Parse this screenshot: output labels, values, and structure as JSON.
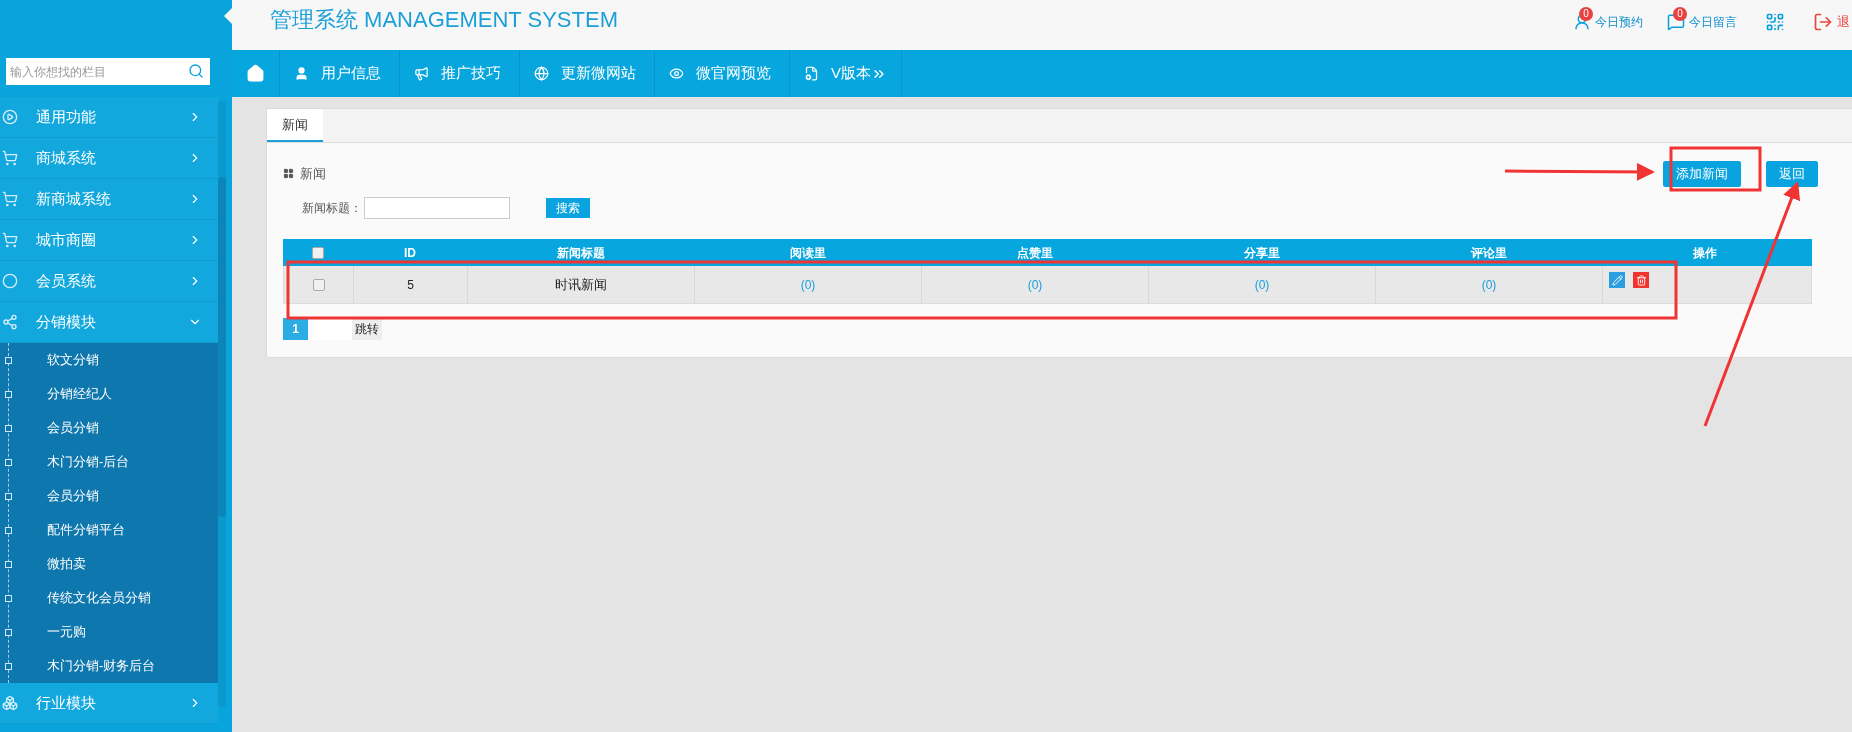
{
  "header": {
    "title": "管理系统 MANAGEMENT SYSTEM",
    "links": [
      {
        "kind": "user",
        "label": "今日预约",
        "badge": "0"
      },
      {
        "kind": "chat",
        "label": "今日留言",
        "badge": "0"
      },
      {
        "kind": "qr"
      },
      {
        "kind": "exit",
        "label": "退"
      }
    ]
  },
  "sidebar": {
    "search": {
      "placeholder": "输入你想找的栏目"
    },
    "items": [
      {
        "kind": "play",
        "label": "通用功能",
        "expanded": false
      },
      {
        "kind": "cart",
        "label": "商城系统",
        "expanded": false
      },
      {
        "kind": "cart",
        "label": "新商城系统",
        "expanded": false
      },
      {
        "kind": "cart",
        "label": "城市商圈",
        "expanded": false
      },
      {
        "kind": "vip",
        "label": "会员系统",
        "expanded": false
      },
      {
        "kind": "share",
        "label": "分销模块",
        "expanded": true,
        "children": [
          {
            "label": "软文分销"
          },
          {
            "label": "分销经纪人"
          },
          {
            "label": "会员分销"
          },
          {
            "label": "木门分销-后台"
          },
          {
            "label": "会员分销"
          },
          {
            "label": "配件分销平台"
          },
          {
            "label": "微拍卖"
          },
          {
            "label": "传统文化会员分销"
          },
          {
            "label": "一元购"
          },
          {
            "label": "木门分销-财务后台"
          }
        ]
      },
      {
        "kind": "grid",
        "label": "行业模块",
        "expanded": false
      }
    ]
  },
  "nav": [
    {
      "kind": "home"
    },
    {
      "kind": "user",
      "label": "用户信息"
    },
    {
      "kind": "megaphone",
      "label": "推广技巧"
    },
    {
      "kind": "globe",
      "label": "更新微网站"
    },
    {
      "kind": "eye",
      "label": "微官网预览"
    },
    {
      "kind": "doc",
      "label": "V版本",
      "more": true
    }
  ],
  "tabs": [
    {
      "label": "新闻",
      "selected": true
    }
  ],
  "panel": {
    "title": "新闻",
    "buttons": [
      {
        "kind": "add",
        "label": "添加新闻"
      },
      {
        "kind": "back",
        "label": "返回"
      }
    ],
    "filter": {
      "label": "新闻标题：",
      "button": "搜索"
    }
  },
  "table": {
    "header_checked": false,
    "columns": [
      "ID",
      "新闻标题",
      "阅读里",
      "点赞里",
      "分享里",
      "评论里",
      "操作"
    ],
    "rows": [
      {
        "checked": false,
        "cells": [
          "5",
          "时讯新闻",
          "(0)",
          "(0)",
          "(0)",
          "(0)"
        ]
      }
    ]
  },
  "pagination": {
    "pages": [
      {
        "label": "1",
        "selected": true
      }
    ],
    "jump": "跳转"
  }
}
